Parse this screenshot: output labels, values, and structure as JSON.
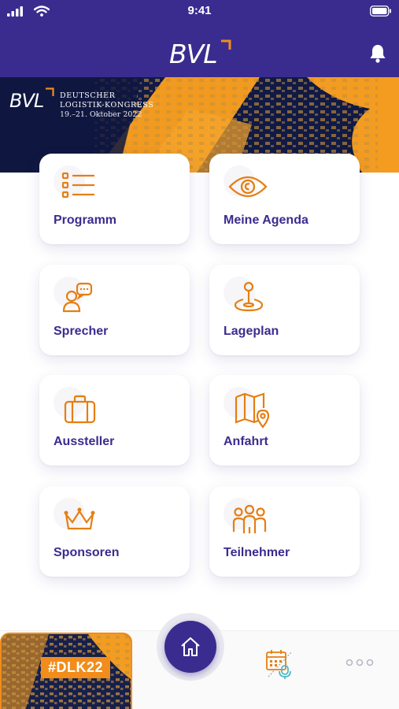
{
  "status_bar": {
    "time": "9:41"
  },
  "header": {
    "logo": "BVL",
    "bell_icon": "bell-icon"
  },
  "banner": {
    "logo": "BVL",
    "line1": "Deutscher",
    "line2": "Logistik-Kongress",
    "date": "19.–21. Oktober 2022"
  },
  "tiles": [
    {
      "label": "Programm",
      "icon": "list-icon"
    },
    {
      "label": "Meine Agenda",
      "icon": "eye-icon"
    },
    {
      "label": "Sprecher",
      "icon": "speaker-icon"
    },
    {
      "label": "Lageplan",
      "icon": "map-pin-icon"
    },
    {
      "label": "Aussteller",
      "icon": "briefcase-icon"
    },
    {
      "label": "Anfahrt",
      "icon": "map-icon"
    },
    {
      "label": "Sponsoren",
      "icon": "crown-icon"
    },
    {
      "label": "Teilnehmer",
      "icon": "people-icon"
    }
  ],
  "bottom_bar": {
    "hashtag": "#DLK22",
    "home_icon": "home-icon",
    "calendar_icon": "calendar-podcast-icon",
    "more_icon": "more-dots-icon"
  },
  "colors": {
    "primary": "#3a2c8f",
    "accent": "#f28c1a",
    "icon_orange": "#e67e12"
  }
}
